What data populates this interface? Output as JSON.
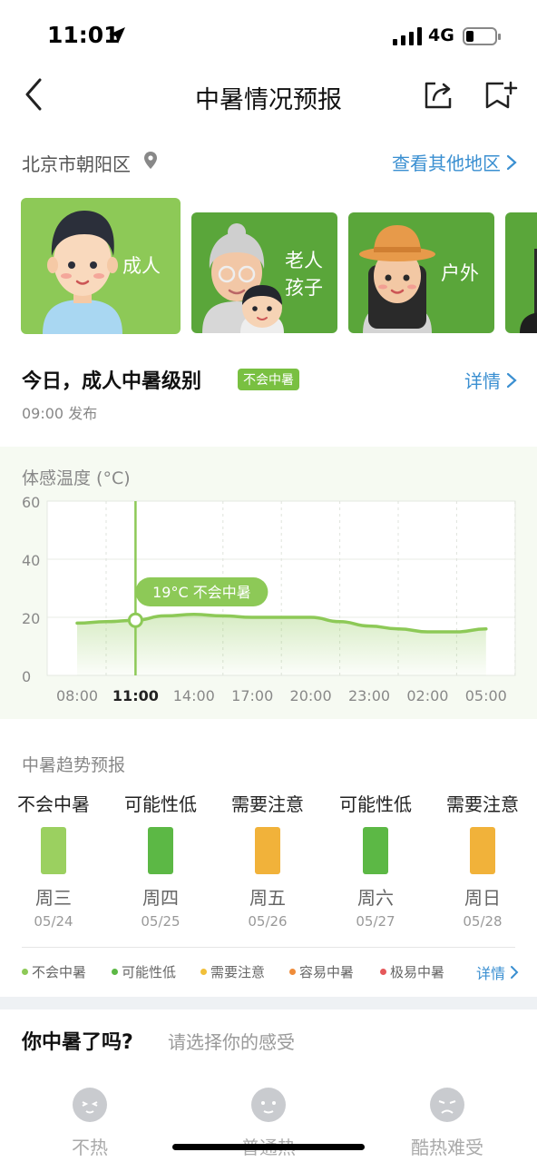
{
  "status_bar": {
    "time": "11:01",
    "network": "4G"
  },
  "nav": {
    "title": "中暑情况预报"
  },
  "location": {
    "city": "北京市朝阳区",
    "other_region": "查看其他地区"
  },
  "categories": [
    {
      "label": "成人",
      "selected": true
    },
    {
      "label_line1": "老人",
      "label_line2": "孩子"
    },
    {
      "label": "户外"
    }
  ],
  "today": {
    "title": "今日，成人中暑级别",
    "level": "不会中暑",
    "detail": "详情",
    "published": "09:00 发布"
  },
  "chart_data": {
    "type": "line",
    "title": "体感温度 (°C)",
    "categories": [
      "08:00",
      "11:00",
      "14:00",
      "17:00",
      "20:00",
      "23:00",
      "02:00",
      "05:00"
    ],
    "x_fine": [
      0,
      0.5,
      1,
      1.5,
      2,
      2.5,
      3,
      3.5,
      4,
      4.5,
      5,
      5.5,
      6,
      6.5,
      7
    ],
    "values": [
      18,
      18.5,
      19,
      20.5,
      21,
      20.5,
      20,
      20,
      20,
      18.5,
      17,
      16,
      15,
      15,
      16
    ],
    "ylim": [
      0,
      60
    ],
    "yticks": [
      0,
      20,
      40,
      60
    ],
    "highlight": {
      "category": "11:00",
      "index": 1,
      "value": 19,
      "label": "19°C 不会中暑"
    },
    "grid": true,
    "color": "#8dc957"
  },
  "trend": {
    "title": "中暑趋势预报",
    "days": [
      {
        "status": "不会中暑",
        "day": "周三",
        "date": "05/24",
        "color": "#9bd060"
      },
      {
        "status": "可能性低",
        "day": "周四",
        "date": "05/25",
        "color": "#5cb845"
      },
      {
        "status": "需要注意",
        "day": "周五",
        "date": "05/26",
        "color": "#f1b23a"
      },
      {
        "status": "可能性低",
        "day": "周六",
        "date": "05/27",
        "color": "#5cb845"
      },
      {
        "status": "需要注意",
        "day": "周日",
        "date": "05/28",
        "color": "#f1b23a"
      }
    ],
    "legend": [
      {
        "label": "不会中暑",
        "color": "#8dc957"
      },
      {
        "label": "可能性低",
        "color": "#5cb845"
      },
      {
        "label": "需要注意",
        "color": "#f1c03a"
      },
      {
        "label": "容易中暑",
        "color": "#ef8c3a"
      },
      {
        "label": "极易中暑",
        "color": "#e5585a"
      }
    ],
    "detail": "详情"
  },
  "feeling": {
    "question": "你中暑了吗?",
    "hint": "请选择你的感受",
    "options": [
      {
        "label": "不热"
      },
      {
        "label": "普通热"
      },
      {
        "label": "酷热难受"
      }
    ]
  }
}
